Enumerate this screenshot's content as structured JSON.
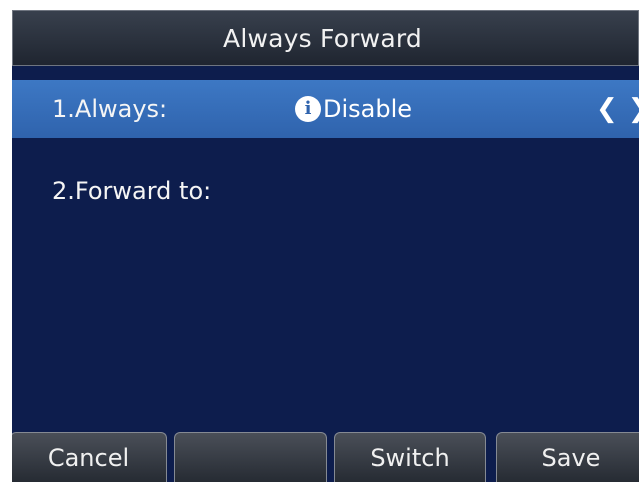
{
  "header": {
    "title": "Always Forward"
  },
  "menu": {
    "items": [
      {
        "label": "1.Always:",
        "value": "Disable",
        "selected": true,
        "value_icon": "info-icon",
        "left_arrow_icon": "chevron-left-icon",
        "right_arrow_icon": "chevron-right-icon"
      },
      {
        "label": "2.Forward to:",
        "value": "",
        "selected": false
      }
    ]
  },
  "softkeys": [
    {
      "label": "Cancel"
    },
    {
      "label": ""
    },
    {
      "label": "Switch"
    },
    {
      "label": "Save"
    }
  ],
  "colors": {
    "background": "#0d1d4d",
    "selected_row": "#3368b3",
    "text": "#ffffff",
    "softkey": "#3a3f48"
  }
}
